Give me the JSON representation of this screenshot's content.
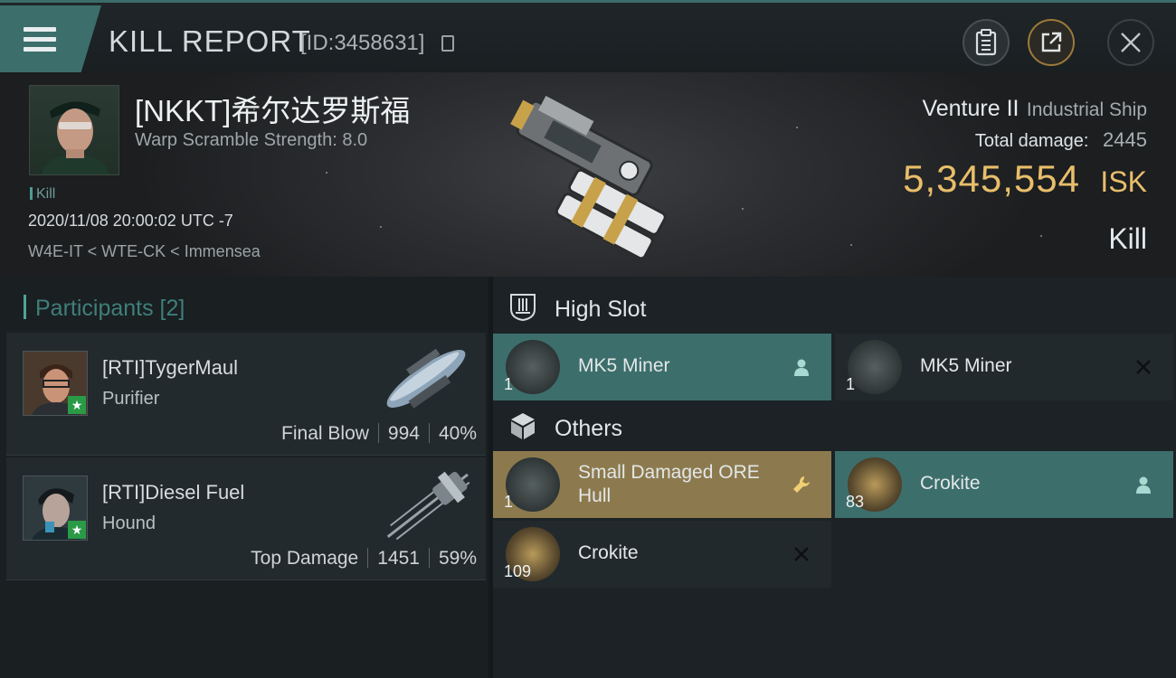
{
  "header": {
    "title": "KILL REPORT",
    "report_id": "[ID:3458631]"
  },
  "victim": {
    "name": "[NKKT]希尔达罗斯福",
    "warp_scramble": "Warp Scramble Strength: 8.0",
    "kill_tag": "Kill",
    "time": "2020/11/08 20:00:02 UTC -7",
    "location": "W4E-IT < WTE-CK < Immensea",
    "ship_name": "Venture II",
    "ship_class": "Industrial Ship",
    "damage_label": "Total damage:",
    "damage_value": "2445",
    "isk_value": "5,345,554",
    "isk_unit": "ISK",
    "kill_type": "Kill"
  },
  "participants": {
    "header": "Participants [2]",
    "list": [
      {
        "name": "[RTI]TygerMaul",
        "ship": "Purifier",
        "role": "Final Blow",
        "damage": "994",
        "percent": "40%"
      },
      {
        "name": "[RTI]Diesel Fuel",
        "ship": "Hound",
        "role": "Top Damage",
        "damage": "1451",
        "percent": "59%"
      }
    ]
  },
  "fitting": {
    "high_slot": {
      "label": "High Slot",
      "items": [
        {
          "name": "MK5 Miner",
          "qty": "1",
          "status": "dropped"
        },
        {
          "name": "MK5 Miner",
          "qty": "1",
          "status": "destroyed"
        }
      ]
    },
    "others": {
      "label": "Others",
      "items": [
        {
          "name": "Small Damaged ORE Hull",
          "qty": "1",
          "status": "hull"
        },
        {
          "name": "Crokite",
          "qty": "83",
          "status": "dropped"
        },
        {
          "name": "Crokite",
          "qty": "109",
          "status": "destroyed"
        }
      ]
    }
  },
  "colors": {
    "accent_teal": "#3c6e6c",
    "isk_gold": "#e8be6a",
    "hull_gold": "#8c7a4e"
  },
  "icons": {
    "menu": "menu-icon",
    "copy": "copy-icon",
    "clipboard": "clipboard-icon",
    "share": "share-icon",
    "close": "close-icon",
    "high_slot": "high-slot-icon",
    "others": "cube-icon",
    "dropped": "person-icon",
    "destroyed": "x-icon",
    "hull": "wrench-icon"
  }
}
